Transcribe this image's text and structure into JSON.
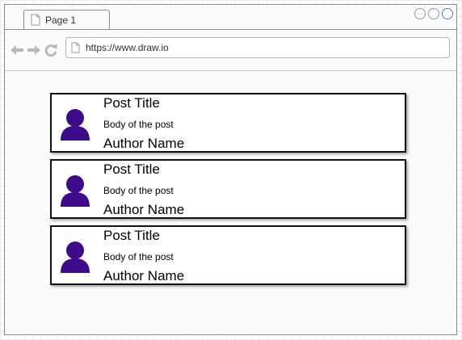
{
  "browser": {
    "tab": {
      "label": "Page 1"
    },
    "address": {
      "url": "https://www.draw.io"
    }
  },
  "posts": [
    {
      "title": "Post Title",
      "body": "Body of the post",
      "author": "Author Name"
    },
    {
      "title": "Post Title",
      "body": "Body of the post",
      "author": "Author Name"
    },
    {
      "title": "Post Title",
      "body": "Body of the post",
      "author": "Author Name"
    }
  ],
  "colors": {
    "avatar": "#3d0a8a",
    "nav_icon": "#b8b8b8",
    "border": "#111111"
  },
  "icons": [
    "page-icon",
    "back-arrow-icon",
    "forward-arrow-icon",
    "reload-icon",
    "user-icon"
  ]
}
